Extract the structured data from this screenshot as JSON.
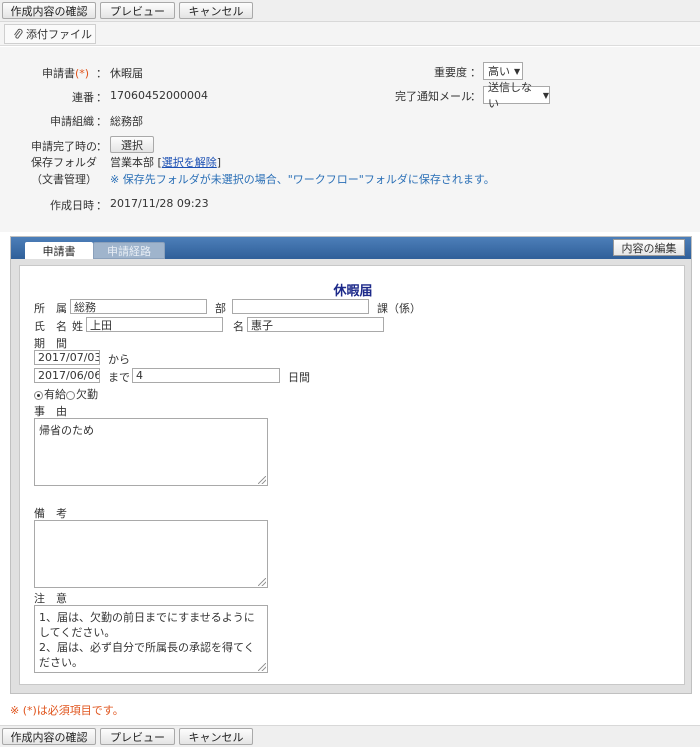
{
  "toolbar": {
    "confirm_label": "作成内容の確認",
    "preview_label": "プレビュー",
    "cancel_label": "キャンセル"
  },
  "attach": {
    "label": "添付ファイル"
  },
  "info": {
    "form_label": "申請書",
    "required_mark": "(*)",
    "colon": "：",
    "form_value": "休暇届",
    "serial_label": "連番",
    "serial_value": "17060452000004",
    "org_label": "申請組織",
    "org_value": "総務部",
    "folder_label_1": "申請完了時の",
    "folder_label_2": "保存フォルダ",
    "folder_label_3": "（文書管理）",
    "select_button": "選択",
    "folder_value": "営業本部",
    "unselect_link": "選択を解除",
    "folder_note": "※ 保存先フォルダが未選択の場合、\"ワークフロー\"フォルダに保存されます。",
    "created_label": "作成日時",
    "created_value": "2017/11/28 09:23",
    "priority_label": "重要度",
    "priority_value": "高い",
    "notify_label": "完了通知メール",
    "notify_value": "送信しない"
  },
  "tabs": {
    "active": "申請書",
    "inactive": "申請経路",
    "edit_button": "内容の編集"
  },
  "form": {
    "title": "休暇届",
    "dept_label": "所　属",
    "dept_value": "総務",
    "bu_label": "部",
    "bu_value": "",
    "section_label": "課（係）",
    "name_label": "氏　名",
    "last_label": "姓",
    "last_value": "上田",
    "first_label": "名",
    "first_value": "惠子",
    "period_label": "期　間",
    "from_date": "2017/07/03",
    "from_suffix": "から",
    "to_date": "2017/06/06",
    "to_suffix": "まで",
    "days_value": "4",
    "days_suffix": "日間",
    "paid_label": "有給",
    "absence_label": "欠勤",
    "reason_label": "事　由",
    "reason_value": "帰省のため",
    "note_label": "備　考",
    "note_value": "",
    "caution_label": "注　意",
    "caution_line1": "1、届は、欠勤の前日までにすませるようにしてください。",
    "caution_line2": "2、届は、必ず自分で所属長の承認を得てください。"
  },
  "footnote": "※ (*)は必須項目です。"
}
